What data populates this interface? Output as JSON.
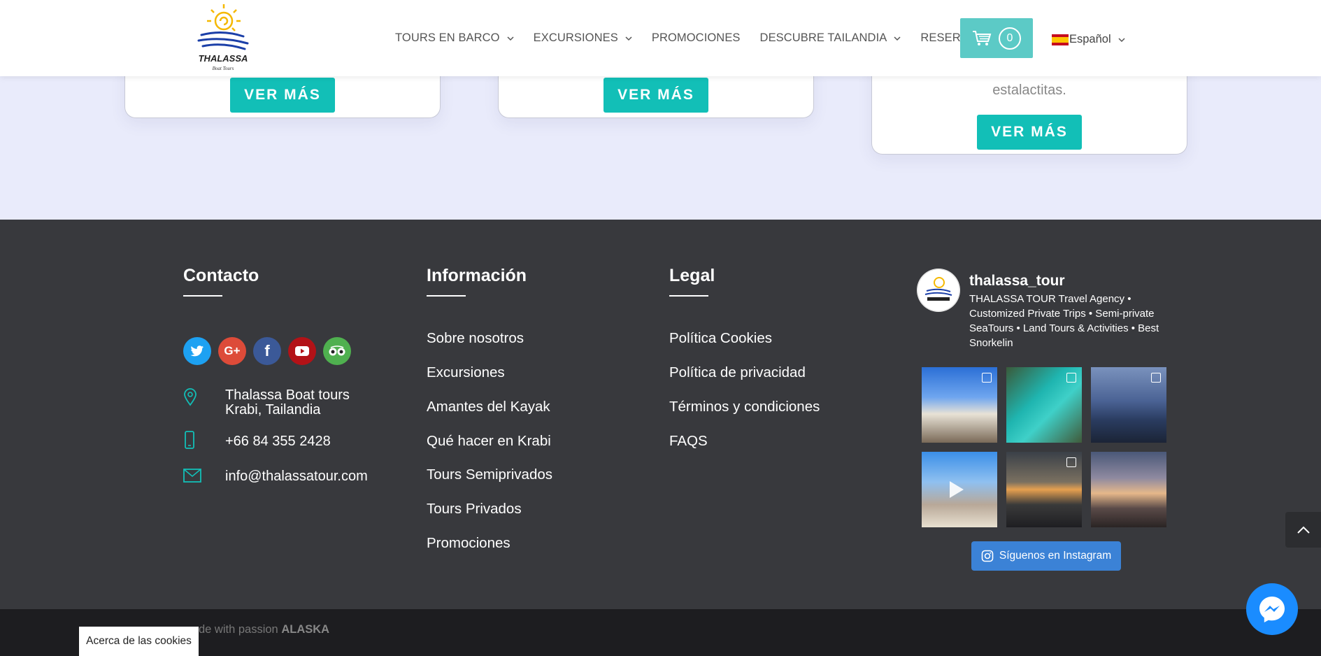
{
  "header": {
    "logo_text": "THALASSA",
    "logo_sub": "Boat Tours",
    "nav": [
      {
        "label": "TOURS EN BARCO",
        "dropdown": true
      },
      {
        "label": "EXCURSIONES",
        "dropdown": true
      },
      {
        "label": "PROMOCIONES",
        "dropdown": false
      },
      {
        "label": "DESCUBRE TAILANDIA",
        "dropdown": true
      },
      {
        "label": "RESERVAR",
        "dropdown": false
      }
    ],
    "cart_count": "0",
    "language": "Español",
    "accent_color": "#5ccac6"
  },
  "cards": {
    "card3_text": "estalactitas.",
    "button_label": "VER MÁS",
    "button_color": "#12bfb7"
  },
  "footer": {
    "contact": {
      "title": "Contacto",
      "social": [
        "twitter-icon",
        "google-plus-icon",
        "facebook-icon",
        "youtube-icon",
        "tripadvisor-icon"
      ],
      "address_line1": "Thalassa Boat tours",
      "address_line2": "Krabi, Tailandia",
      "phone": "+66 84 355 2428",
      "email": "info@thalassatour.com"
    },
    "info": {
      "title": "Información",
      "links": [
        "Sobre nosotros",
        "Excursiones",
        "Amantes del Kayak",
        "Qué hacer en Krabi",
        "Tours Semiprivados",
        "Tours Privados",
        "Promociones"
      ]
    },
    "legal": {
      "title": "Legal",
      "links": [
        "Política Cookies",
        "Política de privacidad",
        "Términos y condiciones",
        "FAQS"
      ]
    },
    "instagram": {
      "username": "thalassa_tour",
      "bio": "THALASSA TOUR Travel Agency • Customized Private Trips • Semi-private SeaTours • Land Tours & Activities • Best Snorkelin",
      "follow_label": "Síguenos en Instagram"
    },
    "credit_prefix": "de with passion",
    "credit_brand": "ALASKA"
  },
  "cookies_label": "Acerca de las cookies"
}
